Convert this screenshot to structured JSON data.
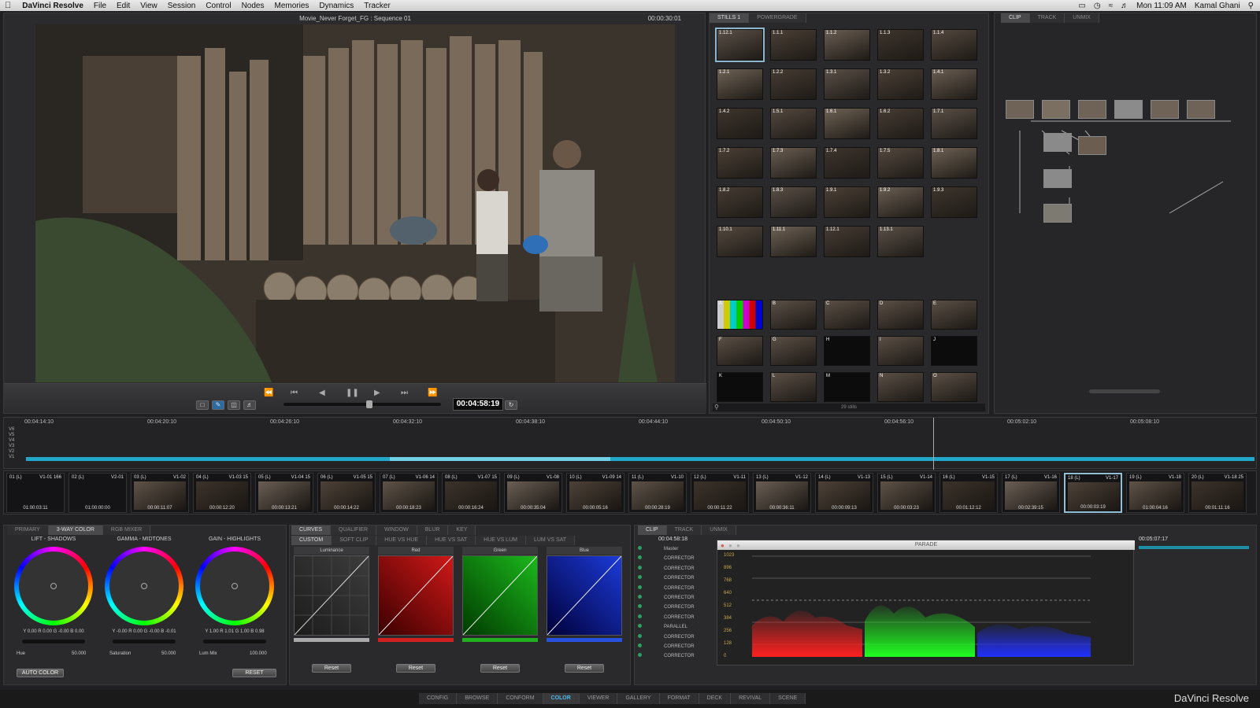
{
  "menubar": {
    "app": "DaVinci Resolve",
    "items": [
      "File",
      "Edit",
      "View",
      "Session",
      "Control",
      "Nodes",
      "Memories",
      "Dynamics",
      "Tracker"
    ],
    "clock": "Mon 11:09 AM",
    "user": "Kamal Ghani"
  },
  "viewer": {
    "title": "Movie_Never Forget_FG : Sequence 01",
    "timecode": "00:00:30:01",
    "transport_timecode": "00:04:58:19"
  },
  "stills": {
    "tabs": [
      "STILLS 1",
      "POWERGRADE"
    ],
    "labels": [
      "1.12.1",
      "1.1.1",
      "1.1.2",
      "1.1.3",
      "1.1.4",
      "1.2.1",
      "1.2.2",
      "1.3.1",
      "1.3.2",
      "1.4.1",
      "1.4.2",
      "1.5.1",
      "1.6.1",
      "1.6.2",
      "1.7.1",
      "1.7.2",
      "1.7.3",
      "1.7.4",
      "1.7.5",
      "1.8.1",
      "1.8.2",
      "1.8.3",
      "1.9.1",
      "1.9.2",
      "1.9.3",
      "1.10.1",
      "1.11.1",
      "1.12.1",
      "1.13.1"
    ],
    "memories": [
      "A",
      "B",
      "C",
      "D",
      "E",
      "F",
      "G",
      "H",
      "I",
      "J",
      "K",
      "L",
      "M",
      "N",
      "O"
    ],
    "count": "29 stills"
  },
  "nodes": {
    "tabs": [
      "CLIP",
      "TRACK",
      "UNMIX"
    ]
  },
  "timeline": {
    "ticks": [
      "00:04:14:10",
      "00:04:20:10",
      "00:04:26:10",
      "00:04:32:10",
      "00:04:38:10",
      "00:04:44:10",
      "00:04:50:10",
      "00:04:56:10",
      "00:05:02:10",
      "00:05:08:10"
    ],
    "tracks": [
      "V6",
      "V5",
      "V4",
      "V3",
      "V2",
      "V1"
    ]
  },
  "clips": [
    {
      "n": "01 (L)",
      "v": "V1-01 166",
      "t": "01:00:03:11"
    },
    {
      "n": "02 (L)",
      "v": "V2-01",
      "t": "01:00:00:00"
    },
    {
      "n": "03 (L)",
      "v": "V1-02",
      "t": "00:00:11:07"
    },
    {
      "n": "04 (L)",
      "v": "V1-03 15",
      "t": "00:00:12:20"
    },
    {
      "n": "05 (L)",
      "v": "V1-04 15",
      "t": "00:00:13:21"
    },
    {
      "n": "06 (L)",
      "v": "V1-05 15",
      "t": "00:00:14:22"
    },
    {
      "n": "07 (L)",
      "v": "V1-06 14",
      "t": "00:00:18:23"
    },
    {
      "n": "08 (L)",
      "v": "V1-07 15",
      "t": "00:00:16:24"
    },
    {
      "n": "09 (L)",
      "v": "V1-08",
      "t": "00:00:35:04"
    },
    {
      "n": "10 (L)",
      "v": "V1-09 14",
      "t": "00:00:05:16"
    },
    {
      "n": "11 (L)",
      "v": "V1-10",
      "t": "00:00:28:19"
    },
    {
      "n": "12 (L)",
      "v": "V1-11",
      "t": "00:00:11:22"
    },
    {
      "n": "13 (L)",
      "v": "V1-12",
      "t": "00:00:36:11"
    },
    {
      "n": "14 (L)",
      "v": "V1-13",
      "t": "00:00:09:13"
    },
    {
      "n": "15 (L)",
      "v": "V1-14",
      "t": "00:00:03:23"
    },
    {
      "n": "16 (L)",
      "v": "V1-15",
      "t": "00:01:12:12"
    },
    {
      "n": "17 (L)",
      "v": "V1-16",
      "t": "00:02:39:15"
    },
    {
      "n": "18 (L)",
      "v": "V1-17",
      "t": "00:00:03:19"
    },
    {
      "n": "19 (L)",
      "v": "V1-18",
      "t": "01:00:04:16"
    },
    {
      "n": "20 (L)",
      "v": "V1-18 25",
      "t": "00:01:11:16"
    }
  ],
  "wheels": {
    "tabs": [
      "PRIMARY",
      "3-WAY COLOR",
      "RGB MIXER"
    ],
    "lift": {
      "label": "LIFT - SHADOWS",
      "vals": "Y 0.00  R 0.00  G -0.00  B 0.00"
    },
    "gamma": {
      "label": "GAMMA - MIDTONES",
      "vals": "Y -0.00  R 0.00  G -0.00  B -0.01"
    },
    "gain": {
      "label": "GAIN - HIGHLIGHTS",
      "vals": "Y 1.00  R 1.01  G 1.00  B 0.98"
    },
    "hue": {
      "label": "Hue",
      "val": "50.000"
    },
    "sat": {
      "label": "Saturation",
      "val": "50.000"
    },
    "lum": {
      "label": "Lum Mix",
      "val": "100.000"
    },
    "auto": "AUTO COLOR",
    "reset": "RESET"
  },
  "curves": {
    "tabs": [
      "CURVES",
      "QUALIFIER",
      "WINDOW",
      "BLUR",
      "KEY"
    ],
    "subtabs": [
      "CUSTOM",
      "SOFT CLIP",
      "HUE VS HUE",
      "HUE VS SAT",
      "HUE VS LUM",
      "LUM VS SAT"
    ],
    "channels": [
      "Luminance",
      "Red",
      "Green",
      "Blue"
    ],
    "reset": "Reset"
  },
  "scopes": {
    "tabs": [
      "CLIP",
      "TRACK",
      "UNMIX"
    ],
    "tc": "00:04:58:18",
    "tc2": "00:05:07:17",
    "layers": [
      "Master",
      "CORRECTOR",
      "CORRECTOR",
      "CORRECTOR",
      "CORRECTOR",
      "CORRECTOR",
      "CORRECTOR",
      "CORRECTOR",
      "PARALLEL",
      "CORRECTOR",
      "CORRECTOR",
      "CORRECTOR"
    ],
    "title": "PARADE",
    "scale": [
      "1023",
      "896",
      "768",
      "640",
      "512",
      "384",
      "256",
      "128",
      "0"
    ]
  },
  "pages": [
    "CONFIG",
    "BROWSE",
    "CONFORM",
    "COLOR",
    "VIEWER",
    "GALLERY",
    "FORMAT",
    "DECK",
    "REVIVAL",
    "SCENE"
  ],
  "brand": "DaVinci Resolve"
}
